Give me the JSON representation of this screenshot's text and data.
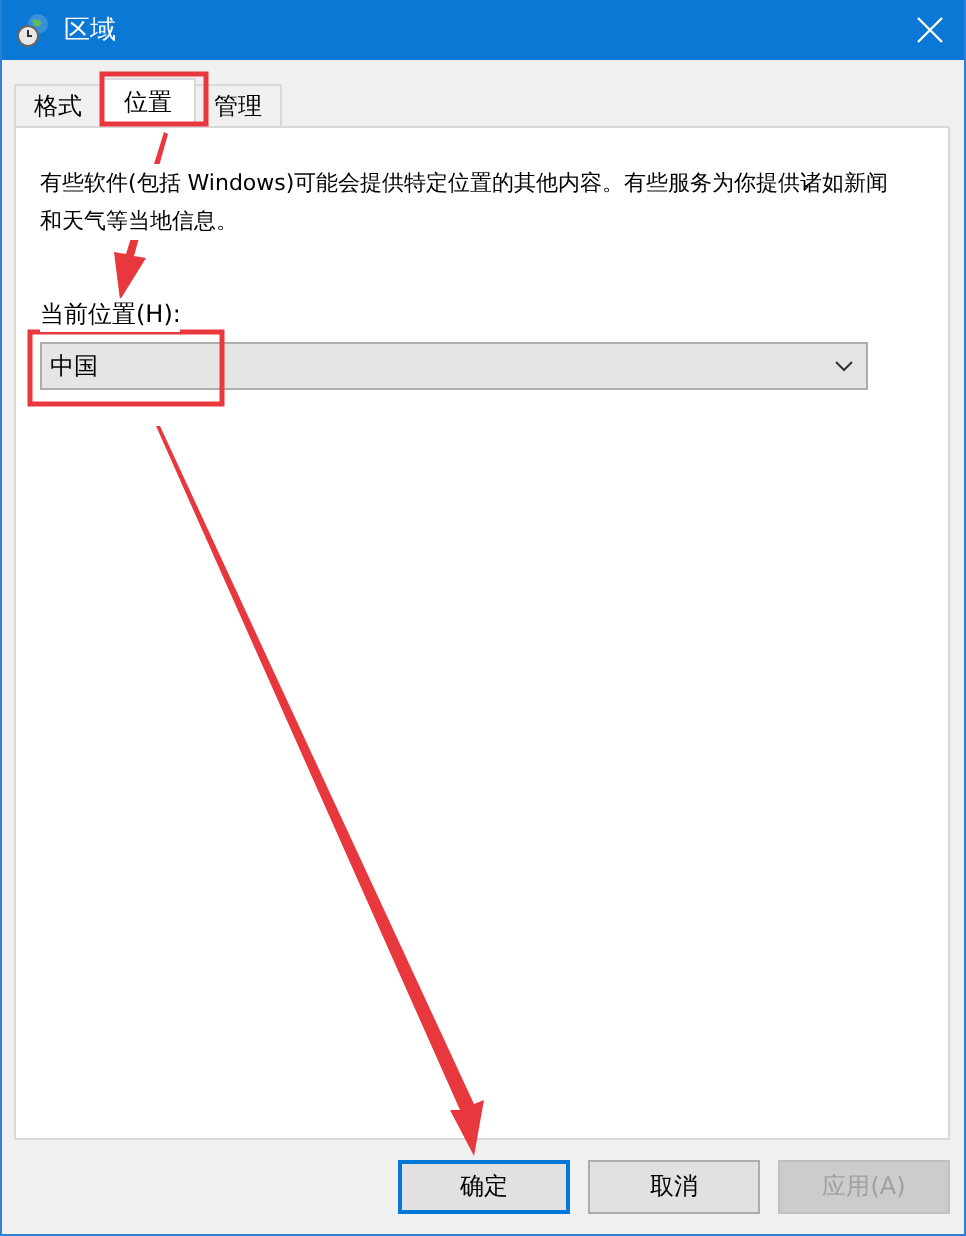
{
  "window": {
    "title": "区域"
  },
  "tabs": [
    {
      "label": "格式",
      "selected": false
    },
    {
      "label": "位置",
      "selected": true
    },
    {
      "label": "管理",
      "selected": false
    }
  ],
  "description": "有些软件(包括 Windows)可能会提供特定位置的其他内容。有些服务为你提供诸如新闻和天气等当地信息。",
  "location": {
    "label": "当前位置(H):",
    "value": "中国"
  },
  "buttons": [
    {
      "label": "确定",
      "default": true,
      "disabled": false
    },
    {
      "label": "取消",
      "default": false,
      "disabled": false
    },
    {
      "label": "应用(A)",
      "default": false,
      "disabled": true
    }
  ]
}
